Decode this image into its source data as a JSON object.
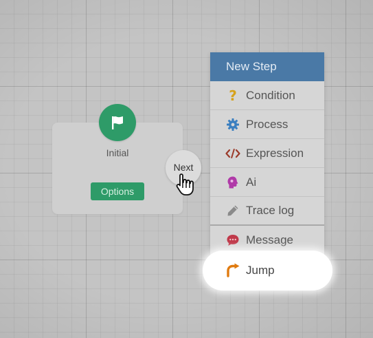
{
  "node": {
    "title": "Initial",
    "options_label": "Options",
    "icon": "flag-icon",
    "color": "#2e9b68"
  },
  "connector": {
    "label": "Next"
  },
  "menu": {
    "header": "New Step",
    "header_color": "#4a79a6",
    "items": [
      {
        "label": "Condition",
        "icon": "question-icon",
        "color": "#d6a21c"
      },
      {
        "label": "Process",
        "icon": "gear-icon",
        "color": "#3a7fc0"
      },
      {
        "label": "Expression",
        "icon": "code-icon",
        "color": "#9b3a2a"
      },
      {
        "label": "Ai",
        "icon": "brain-icon",
        "color": "#b03aa8"
      },
      {
        "label": "Trace log",
        "icon": "pencil-icon",
        "color": "#8a8a8a"
      },
      {
        "label": "Message",
        "icon": "chat-icon",
        "color": "#c0394a"
      },
      {
        "label": "Jump",
        "icon": "jump-arrow-icon",
        "color": "#e07b10"
      }
    ]
  }
}
